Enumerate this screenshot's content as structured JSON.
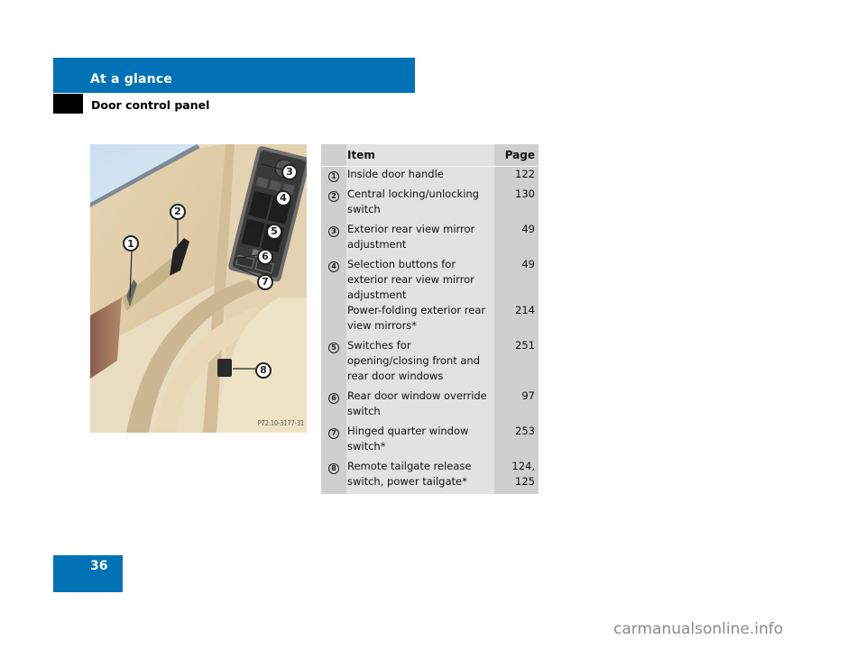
{
  "header": {
    "section_title": "At a glance",
    "subsection_title": "Door control panel",
    "accent_color": "#0072b5"
  },
  "figure": {
    "reference_code": "P72.10-3177-31",
    "callouts": [
      "1",
      "2",
      "3",
      "4",
      "5",
      "6",
      "7",
      "8"
    ]
  },
  "table": {
    "headers": {
      "number": "",
      "item": "Item",
      "page": "Page"
    },
    "rows": [
      {
        "number": "1",
        "item": "Inside door handle",
        "page": "122"
      },
      {
        "number": "2",
        "item": "Central locking/unlocking switch",
        "page": "130"
      },
      {
        "number": "3",
        "item": "Exterior rear view mirror adjustment",
        "page": "49"
      },
      {
        "number": "4",
        "item": "Selection buttons for exterior rear view mirror adjustment",
        "page": "49"
      },
      {
        "number": "",
        "item": "Power-folding exterior rear view mirrors*",
        "page": "214"
      },
      {
        "number": "5",
        "item": "Switches for opening/closing front and rear door windows",
        "page": "251"
      },
      {
        "number": "6",
        "item": "Rear door window override switch",
        "page": "97"
      },
      {
        "number": "7",
        "item": "Hinged quarter window switch*",
        "page": "253"
      },
      {
        "number": "8",
        "item": "Remote tailgate release switch, power tailgate*",
        "page": "124,\n125"
      }
    ]
  },
  "footer": {
    "page_number": "36",
    "watermark": "carmanualsonline.info"
  }
}
